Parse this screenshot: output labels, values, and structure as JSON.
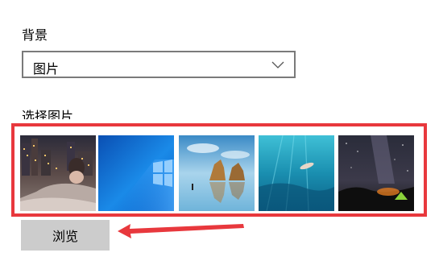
{
  "background": {
    "label": "背景",
    "select": {
      "value": "图片",
      "icon": "chevron-down-icon"
    }
  },
  "pictures": {
    "label": "选择图片",
    "items": [
      {
        "name": "anime-city-night"
      },
      {
        "name": "windows-blue-logo"
      },
      {
        "name": "beach-rocks"
      },
      {
        "name": "underwater-swimmer"
      },
      {
        "name": "night-sky-tent"
      }
    ]
  },
  "browse": {
    "label": "浏览"
  },
  "colors": {
    "highlight": "#e8383d",
    "button": "#cccccc"
  }
}
